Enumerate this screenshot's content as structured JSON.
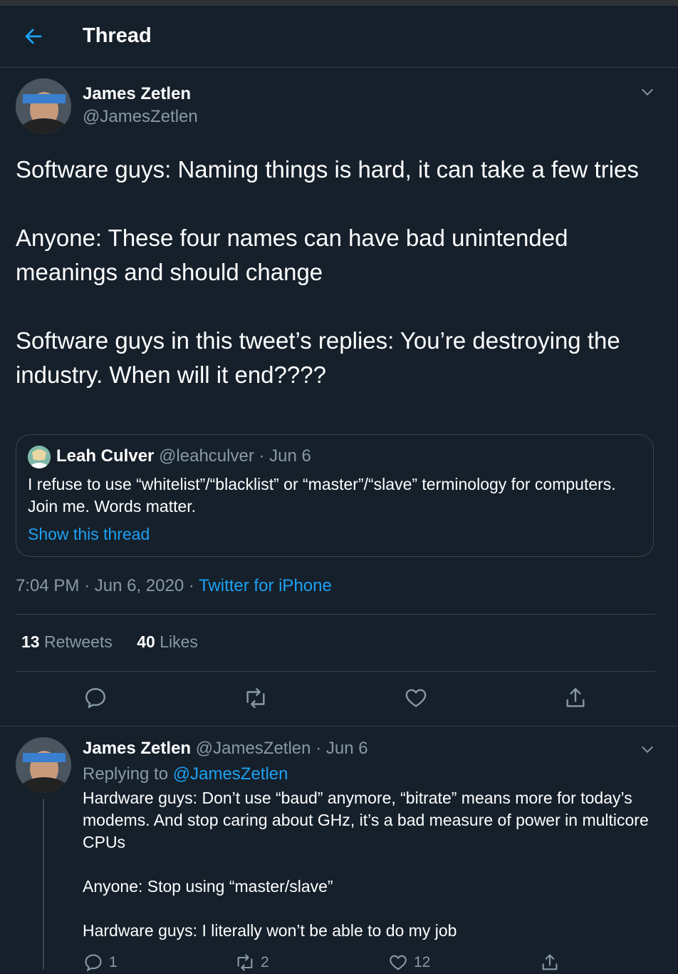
{
  "header": {
    "title": "Thread"
  },
  "tweet": {
    "author_name": "James Zetlen",
    "author_handle": "@JamesZetlen",
    "text": "Software guys: Naming things is hard, it can take a few tries\n\nAnyone: These four names can have bad unintended meanings and should change\n\nSoftware guys in this tweet’s replies: You’re destroying the industry. When will it end????",
    "quote": {
      "author_name": "Leah Culver",
      "author_handle": "@leahculver",
      "date": "Jun 6",
      "text": "I refuse to use “whitelist”/“blacklist” or “master”/“slave” terminology for computers. Join me. Words matter.",
      "link": "Show this thread"
    },
    "time": "7:04 PM",
    "date": "Jun 6, 2020",
    "source": "Twitter for iPhone",
    "retweets_count": "13",
    "retweets_label": "Retweets",
    "likes_count": "40",
    "likes_label": "Likes"
  },
  "reply": {
    "author_name": "James Zetlen",
    "author_handle": "@JamesZetlen",
    "date": "Jun 6",
    "replying_label": "Replying to",
    "replying_handle": "@JamesZetlen",
    "text": "Hardware guys: Don’t use “baud” anymore, “bitrate” means more for today’s modems. And stop caring about GHz, it’s a bad measure of power in multicore CPUs\n\nAnyone: Stop using “master/slave”\n\nHardware guys: I literally won’t be able to do my job",
    "replies": "1",
    "retweets": "2",
    "likes": "12"
  },
  "colors": {
    "background": "#15202b",
    "accent": "#1da1f2",
    "muted": "#8899a6",
    "border": "#38444d"
  }
}
